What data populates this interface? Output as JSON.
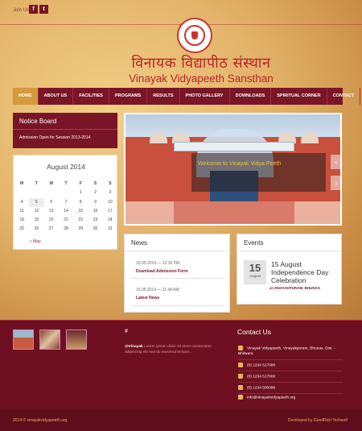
{
  "header": {
    "follow_label": "Join Us",
    "social": [
      "f",
      "t"
    ],
    "title_hindi": "विनायक विद्यापीठ संस्थान",
    "title_english": "Vinayak Vidyapeeth Sansthan"
  },
  "nav": {
    "items": [
      "HOME",
      "ABOUT US",
      "FACILITIES",
      "PROGRAMS",
      "RESULTS",
      "PHOTO GALLERY",
      "DOWNLOADS",
      "SPIRITUAL CORNER",
      "CONTACT"
    ]
  },
  "notice_board": {
    "title": "Notice Board",
    "item": "Admission Open for Session 2013-2014"
  },
  "calendar": {
    "title": "August 2014",
    "weekdays": [
      "M",
      "T",
      "W",
      "T",
      "F",
      "S",
      "S"
    ],
    "days": [
      [
        "",
        "",
        "",
        "",
        "1",
        "2",
        "3"
      ],
      [
        "4",
        "5",
        "6",
        "7",
        "8",
        "9",
        "10"
      ],
      [
        "11",
        "12",
        "13",
        "14",
        "15",
        "16",
        "17"
      ],
      [
        "18",
        "19",
        "20",
        "21",
        "22",
        "23",
        "24"
      ],
      [
        "25",
        "26",
        "27",
        "28",
        "29",
        "30",
        "31"
      ]
    ],
    "prev_label": "« May"
  },
  "slider": {
    "caption": "Welcome to Vinayak Vidya Peeth",
    "prev": "‹",
    "next": "›"
  },
  "news": {
    "title": "News",
    "items": [
      {
        "date": "15.05.2014 — 12:15 PM",
        "link": "Download Admission Form"
      },
      {
        "date": "15.05.2014 — 11:44 AM",
        "link": "Latest News"
      }
    ]
  },
  "events": {
    "title": "Events",
    "day": "15",
    "month": "August",
    "event_title": "15 August Independence Day Celebration",
    "place": "at VINAYAKPURAM, BHUNAS"
  },
  "footer": {
    "hash": "#",
    "tweet_user": "@Vinayak",
    "tweet_text": "Lorem ipsum dolor sit amet consectetur adipiscing elit sed do eiusmod tempor...",
    "contact_title": "Contact Us",
    "address": "Vinayak Vidyapeeth, Vinayakpuram, Bhunas, Dist. - Bhilwara",
    "phones": [
      "(0) 1234 517000",
      "(0) 1234 517000",
      "(0) 1234 500000"
    ],
    "email": "info@vinayakvidyapeeth.org",
    "copyright": "2014 © vinayakvidyapeeth.org",
    "developer": "Developed by GoodRich Techsoft"
  },
  "colors": {
    "maroon": "#7a1427",
    "gold": "#d49a3c",
    "title_red": "#b8242b"
  }
}
